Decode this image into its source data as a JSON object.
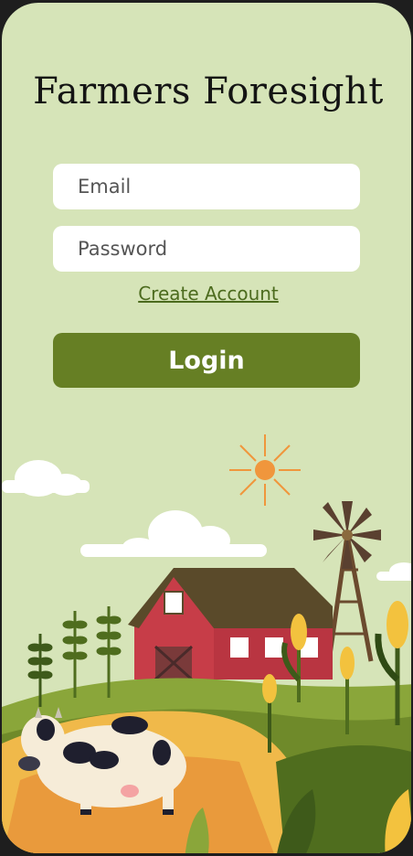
{
  "app": {
    "title": "Farmers Foresight"
  },
  "form": {
    "email_placeholder": "Email",
    "email_value": "",
    "password_placeholder": "Password",
    "password_value": "",
    "create_account_label": "Create Account",
    "login_label": "Login"
  },
  "colors": {
    "background": "#d6e4b8",
    "primary": "#667f24",
    "link": "#4c6b1e",
    "barn": "#c73d48",
    "sun": "#f0963c"
  },
  "illustration": {
    "icons": [
      "cloud-icon",
      "sun-icon",
      "barn-icon",
      "windmill-icon",
      "cow-icon",
      "corn-icon",
      "wheat-icon"
    ]
  }
}
